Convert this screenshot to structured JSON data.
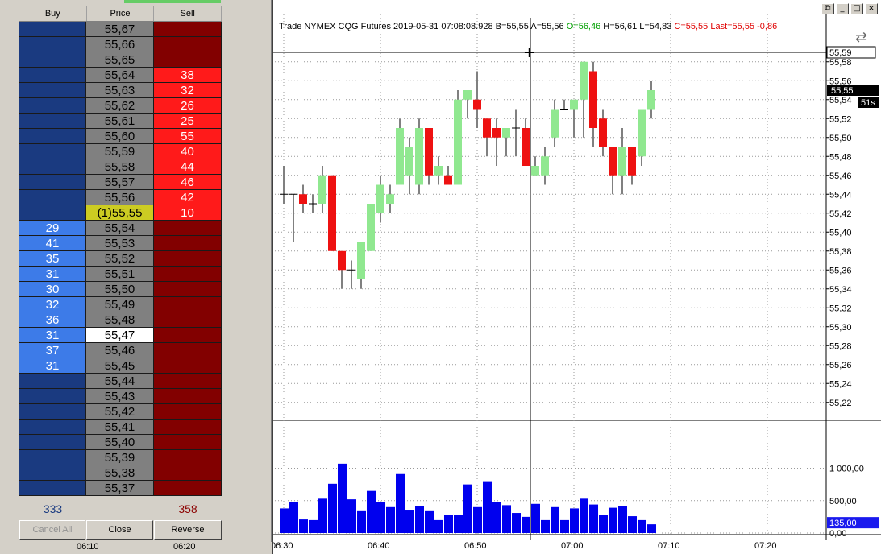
{
  "dom": {
    "headers": {
      "buy": "Buy",
      "price": "Price",
      "sell": "Sell"
    },
    "rows": [
      {
        "price": "55,67",
        "buy": "",
        "sell": "",
        "buy_active": false,
        "sell_active": false,
        "kind": ""
      },
      {
        "price": "55,66",
        "buy": "",
        "sell": "",
        "buy_active": false,
        "sell_active": false,
        "kind": ""
      },
      {
        "price": "55,65",
        "buy": "",
        "sell": "",
        "buy_active": false,
        "sell_active": false,
        "kind": ""
      },
      {
        "price": "55,64",
        "buy": "",
        "sell": "38",
        "buy_active": false,
        "sell_active": true,
        "kind": ""
      },
      {
        "price": "55,63",
        "buy": "",
        "sell": "32",
        "buy_active": false,
        "sell_active": true,
        "kind": ""
      },
      {
        "price": "55,62",
        "buy": "",
        "sell": "26",
        "buy_active": false,
        "sell_active": true,
        "kind": ""
      },
      {
        "price": "55,61",
        "buy": "",
        "sell": "25",
        "buy_active": false,
        "sell_active": true,
        "kind": ""
      },
      {
        "price": "55,60",
        "buy": "",
        "sell": "55",
        "buy_active": false,
        "sell_active": true,
        "kind": ""
      },
      {
        "price": "55,59",
        "buy": "",
        "sell": "40",
        "buy_active": false,
        "sell_active": true,
        "kind": ""
      },
      {
        "price": "55,58",
        "buy": "",
        "sell": "44",
        "buy_active": false,
        "sell_active": true,
        "kind": ""
      },
      {
        "price": "55,57",
        "buy": "",
        "sell": "46",
        "buy_active": false,
        "sell_active": true,
        "kind": ""
      },
      {
        "price": "55,56",
        "buy": "",
        "sell": "42",
        "buy_active": false,
        "sell_active": true,
        "kind": ""
      },
      {
        "price": "(1)55,55",
        "buy": "",
        "sell": "10",
        "buy_active": false,
        "sell_active": true,
        "kind": "last"
      },
      {
        "price": "55,54",
        "buy": "29",
        "sell": "",
        "buy_active": true,
        "sell_active": false,
        "kind": ""
      },
      {
        "price": "55,53",
        "buy": "41",
        "sell": "",
        "buy_active": true,
        "sell_active": false,
        "kind": ""
      },
      {
        "price": "55,52",
        "buy": "35",
        "sell": "",
        "buy_active": true,
        "sell_active": false,
        "kind": ""
      },
      {
        "price": "55,51",
        "buy": "31",
        "sell": "",
        "buy_active": true,
        "sell_active": false,
        "kind": ""
      },
      {
        "price": "55,50",
        "buy": "30",
        "sell": "",
        "buy_active": true,
        "sell_active": false,
        "kind": ""
      },
      {
        "price": "55,49",
        "buy": "32",
        "sell": "",
        "buy_active": true,
        "sell_active": false,
        "kind": ""
      },
      {
        "price": "55,48",
        "buy": "36",
        "sell": "",
        "buy_active": true,
        "sell_active": false,
        "kind": ""
      },
      {
        "price": "55,47",
        "buy": "31",
        "sell": "",
        "buy_active": true,
        "sell_active": false,
        "kind": "cur"
      },
      {
        "price": "55,46",
        "buy": "37",
        "sell": "",
        "buy_active": true,
        "sell_active": false,
        "kind": ""
      },
      {
        "price": "55,45",
        "buy": "31",
        "sell": "",
        "buy_active": true,
        "sell_active": false,
        "kind": ""
      },
      {
        "price": "55,44",
        "buy": "",
        "sell": "",
        "buy_active": false,
        "sell_active": false,
        "kind": ""
      },
      {
        "price": "55,43",
        "buy": "",
        "sell": "",
        "buy_active": false,
        "sell_active": false,
        "kind": ""
      },
      {
        "price": "55,42",
        "buy": "",
        "sell": "",
        "buy_active": false,
        "sell_active": false,
        "kind": ""
      },
      {
        "price": "55,41",
        "buy": "",
        "sell": "",
        "buy_active": false,
        "sell_active": false,
        "kind": ""
      },
      {
        "price": "55,40",
        "buy": "",
        "sell": "",
        "buy_active": false,
        "sell_active": false,
        "kind": ""
      },
      {
        "price": "55,39",
        "buy": "",
        "sell": "",
        "buy_active": false,
        "sell_active": false,
        "kind": ""
      },
      {
        "price": "55,38",
        "buy": "",
        "sell": "",
        "buy_active": false,
        "sell_active": false,
        "kind": ""
      },
      {
        "price": "55,37",
        "buy": "",
        "sell": "",
        "buy_active": false,
        "sell_active": false,
        "kind": ""
      }
    ],
    "total_buy": "333",
    "total_sell": "358",
    "buttons": {
      "cancel_all": "Cancel All",
      "close": "Close",
      "reverse": "Reverse"
    },
    "bottom_time_labels": [
      "06:10",
      "06:20"
    ]
  },
  "chart_window": {
    "buttons": {
      "restore": "⧉",
      "minimize": "_",
      "maximize": "□",
      "close": "×"
    },
    "title": {
      "prefix": "Trade  NYMEX  CQG  Futures  2019-05-31  07:08:08.928  B=55,55  A=55,56",
      "open": "O=56,46",
      "hl": "H=56,61  L=54,83",
      "close_last": "C=55,55  Last=55,55  -0,86"
    },
    "tool_icon": "trend-arrows-icon",
    "crosshair_price_label": "55,59",
    "last_price_label": "55,55",
    "countdown_label": "51s",
    "volume_current_label": "135,00",
    "colors": {
      "up": "#90e890",
      "down": "#ee1111",
      "volume": "#0000ee",
      "last_tag": "#000000",
      "volume_tag": "#1a1aee"
    }
  },
  "chart_data": [
    {
      "type": "candlestick",
      "title": "",
      "price_axis_ticks": [
        "55,58",
        "55,56",
        "55,54",
        "55,52",
        "55,50",
        "55,48",
        "55,46",
        "55,44",
        "55,42",
        "55,40",
        "55,38",
        "55,36",
        "55,34",
        "55,32",
        "55,30",
        "55,28",
        "55,26",
        "55,24",
        "55,22"
      ],
      "time_axis_ticks": [
        "06:30",
        "06:40",
        "06:50",
        "07:00",
        "07:10",
        "07:20"
      ],
      "ylim": [
        55.21,
        55.605
      ],
      "bar_minutes": 1,
      "start_time": "06:30",
      "candles": [
        {
          "o": 55.44,
          "h": 55.47,
          "l": 55.43,
          "c": 55.44
        },
        {
          "o": 55.44,
          "h": 55.44,
          "l": 55.39,
          "c": 55.44
        },
        {
          "o": 55.44,
          "h": 55.45,
          "l": 55.42,
          "c": 55.43
        },
        {
          "o": 55.43,
          "h": 55.44,
          "l": 55.42,
          "c": 55.43
        },
        {
          "o": 55.43,
          "h": 55.47,
          "l": 55.42,
          "c": 55.46
        },
        {
          "o": 55.46,
          "h": 55.46,
          "l": 55.38,
          "c": 55.38
        },
        {
          "o": 55.38,
          "h": 55.38,
          "l": 55.34,
          "c": 55.36
        },
        {
          "o": 55.36,
          "h": 55.37,
          "l": 55.34,
          "c": 55.36
        },
        {
          "o": 55.35,
          "h": 55.39,
          "l": 55.34,
          "c": 55.39
        },
        {
          "o": 55.38,
          "h": 55.43,
          "l": 55.38,
          "c": 55.43
        },
        {
          "o": 55.42,
          "h": 55.46,
          "l": 55.41,
          "c": 55.45
        },
        {
          "o": 55.43,
          "h": 55.45,
          "l": 55.42,
          "c": 55.44
        },
        {
          "o": 55.45,
          "h": 55.52,
          "l": 55.45,
          "c": 55.51
        },
        {
          "o": 55.46,
          "h": 55.5,
          "l": 55.44,
          "c": 55.49
        },
        {
          "o": 55.45,
          "h": 55.52,
          "l": 55.44,
          "c": 55.51
        },
        {
          "o": 55.51,
          "h": 55.51,
          "l": 55.45,
          "c": 55.46
        },
        {
          "o": 55.46,
          "h": 55.48,
          "l": 55.45,
          "c": 55.47
        },
        {
          "o": 55.46,
          "h": 55.47,
          "l": 55.45,
          "c": 55.45
        },
        {
          "o": 55.45,
          "h": 55.55,
          "l": 55.45,
          "c": 55.54
        },
        {
          "o": 55.54,
          "h": 55.55,
          "l": 55.52,
          "c": 55.55
        },
        {
          "o": 55.54,
          "h": 55.57,
          "l": 55.51,
          "c": 55.53
        },
        {
          "o": 55.52,
          "h": 55.52,
          "l": 55.48,
          "c": 55.5
        },
        {
          "o": 55.51,
          "h": 55.52,
          "l": 55.47,
          "c": 55.5
        },
        {
          "o": 55.5,
          "h": 55.51,
          "l": 55.48,
          "c": 55.51
        },
        {
          "o": 55.51,
          "h": 55.53,
          "l": 55.48,
          "c": 55.51
        },
        {
          "o": 55.51,
          "h": 55.52,
          "l": 55.47,
          "c": 55.47
        },
        {
          "o": 55.46,
          "h": 55.48,
          "l": 55.46,
          "c": 55.47
        },
        {
          "o": 55.46,
          "h": 55.49,
          "l": 55.45,
          "c": 55.48
        },
        {
          "o": 55.5,
          "h": 55.54,
          "l": 55.49,
          "c": 55.53
        },
        {
          "o": 55.53,
          "h": 55.54,
          "l": 55.53,
          "c": 55.53
        },
        {
          "o": 55.53,
          "h": 55.54,
          "l": 55.5,
          "c": 55.54
        },
        {
          "o": 55.54,
          "h": 55.58,
          "l": 55.5,
          "c": 55.58
        },
        {
          "o": 55.57,
          "h": 55.58,
          "l": 55.49,
          "c": 55.51
        },
        {
          "o": 55.52,
          "h": 55.53,
          "l": 55.48,
          "c": 55.49
        },
        {
          "o": 55.49,
          "h": 55.49,
          "l": 55.44,
          "c": 55.46
        },
        {
          "o": 55.46,
          "h": 55.51,
          "l": 55.44,
          "c": 55.49
        },
        {
          "o": 55.49,
          "h": 55.49,
          "l": 55.45,
          "c": 55.46
        },
        {
          "o": 55.48,
          "h": 55.53,
          "l": 55.47,
          "c": 55.53
        },
        {
          "o": 55.53,
          "h": 55.56,
          "l": 55.52,
          "c": 55.55
        }
      ]
    },
    {
      "type": "bar",
      "title": "",
      "axis_ticks": [
        "1 000,00",
        "500,00",
        "0,00"
      ],
      "ylim": [
        0,
        1400
      ],
      "values": [
        380,
        480,
        210,
        200,
        530,
        760,
        1070,
        520,
        350,
        650,
        480,
        400,
        910,
        360,
        420,
        350,
        200,
        280,
        280,
        750,
        400,
        800,
        480,
        430,
        310,
        250,
        450,
        200,
        400,
        200,
        380,
        530,
        440,
        280,
        390,
        410,
        260,
        200,
        135
      ]
    }
  ]
}
